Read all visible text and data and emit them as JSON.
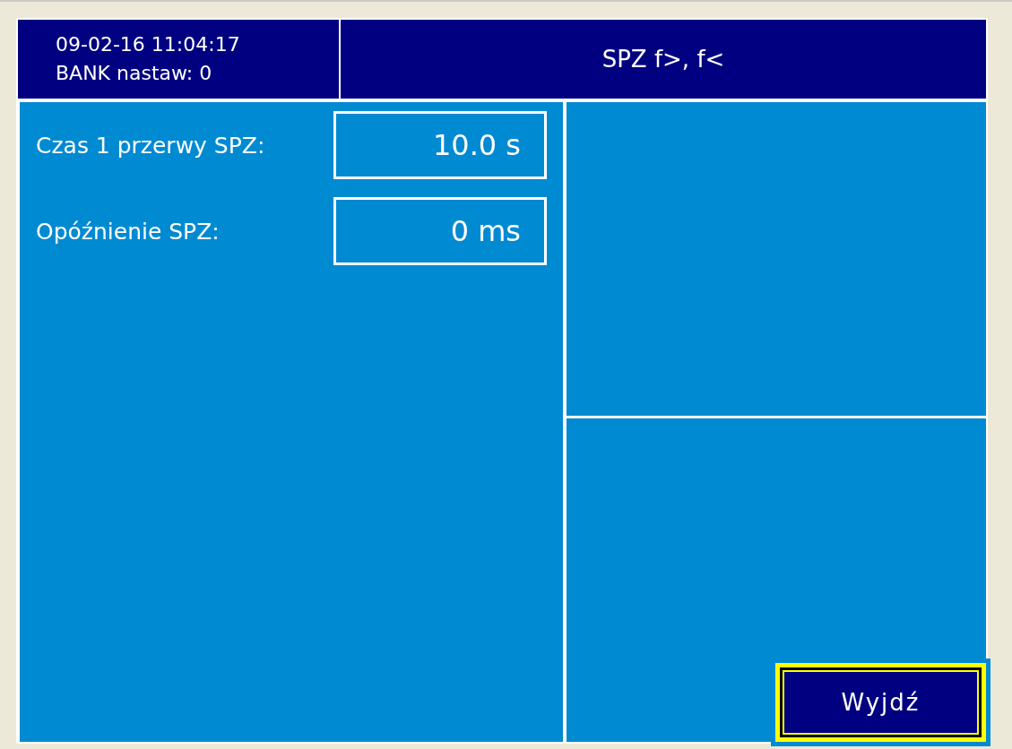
{
  "header": {
    "datetime": "09-02-16 11:04:17",
    "bank": "BANK nastaw: 0",
    "title": "SPZ f>, f<"
  },
  "settings": [
    {
      "label": "Czas 1 przerwy SPZ:",
      "value": "10.0 s"
    },
    {
      "label": "Opóźnienie SPZ:",
      "value": "0 ms"
    }
  ],
  "exit_button": {
    "label": "Wyjdź"
  }
}
